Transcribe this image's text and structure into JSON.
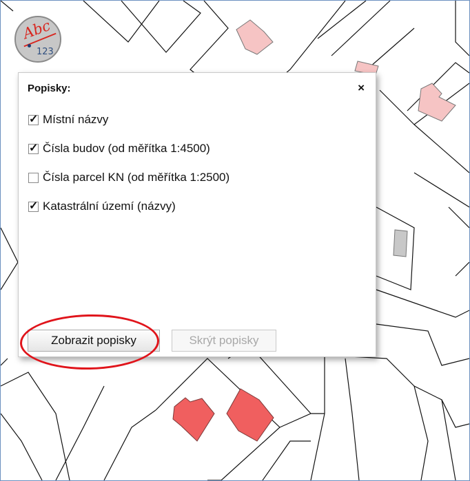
{
  "map": {
    "layer_button_text_top": "Abc",
    "layer_button_text_bottom": "123"
  },
  "popup": {
    "title": "Popisky:",
    "close_label": "×",
    "options": [
      {
        "label": "Místní názvy",
        "checked": true
      },
      {
        "label": "Čísla budov (od měřítka 1:4500)",
        "checked": true
      },
      {
        "label": "Čísla parcel KN (od měřítka 1:2500)",
        "checked": false
      },
      {
        "label": "Katastrální území (názvy)",
        "checked": true
      }
    ],
    "show_button": "Zobrazit popisky",
    "hide_button": "Skrýt popisky",
    "hide_button_disabled": true
  },
  "colors": {
    "building_fill_light": "#f6c4c4",
    "building_fill_strong": "#f05f5f",
    "highlight_ring": "#e0141b"
  }
}
